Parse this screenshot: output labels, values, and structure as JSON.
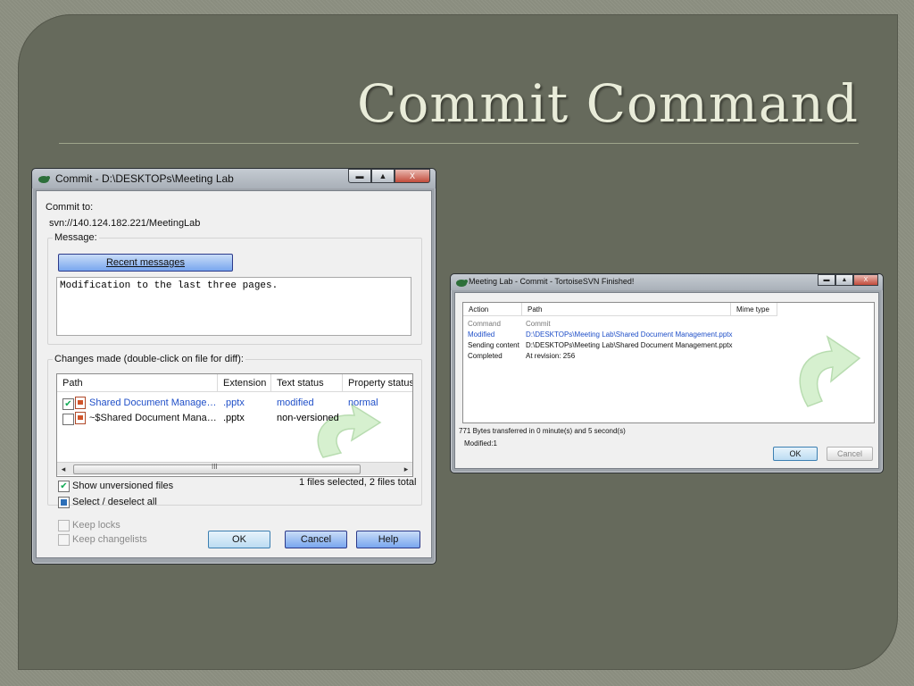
{
  "slide": {
    "title": "Commit Command"
  },
  "commit_dialog": {
    "title": "Commit - D:\\DESKTOPs\\Meeting Lab",
    "commit_to_label": "Commit to:",
    "repo_url": "svn://140.124.182.221/MeetingLab",
    "message_label": "Message:",
    "recent_messages_button": "Recent messages",
    "message_text": "Modification to the last three pages.",
    "changes_label": "Changes made (double-click on file for diff):",
    "columns": [
      "Path",
      "Extension",
      "Text status",
      "Property status"
    ],
    "rows": [
      {
        "checked": true,
        "path": "Shared Document Manage…",
        "extension": ".pptx",
        "text_status": "modified",
        "property_status": "normal"
      },
      {
        "checked": false,
        "path": "~$Shared Document Mana…",
        "extension": ".pptx",
        "text_status": "non-versioned",
        "property_status": ""
      }
    ],
    "scroll_grip": "III",
    "show_unversioned_label": "Show unversioned files",
    "selection_summary": "1 files selected, 2 files total",
    "select_all_label": "Select / deselect all",
    "keep_locks_label": "Keep locks",
    "keep_changelists_label": "Keep changelists",
    "ok_button": "OK",
    "cancel_button": "Cancel",
    "help_button": "Help"
  },
  "finished_dialog": {
    "title": "Meeting Lab - Commit - TortoiseSVN Finished!",
    "columns": [
      "Action",
      "Path",
      "Mime type"
    ],
    "rows": [
      {
        "action": "Command",
        "path": "Commit",
        "kind": "muted"
      },
      {
        "action": "Modified",
        "path": "D:\\DESKTOPs\\Meeting Lab\\Shared Document Management.pptx",
        "kind": "blue"
      },
      {
        "action": "Sending content",
        "path": "D:\\DESKTOPs\\Meeting Lab\\Shared Document Management.pptx",
        "kind": "normal"
      },
      {
        "action": "Completed",
        "path": "At revision: 256",
        "kind": "normal"
      }
    ],
    "transfer_text": "771 Bytes transferred in 0 minute(s) and 5 second(s)",
    "modified_count_text": "Modified:1",
    "ok_button": "OK",
    "cancel_button": "Cancel"
  },
  "window_controls": {
    "minimize": "▬",
    "maximize": "▲",
    "close": "X"
  },
  "colors": {
    "accent_blue": "#1f4fc8",
    "slide_bg": "#666a5c",
    "title_text": "#e9ecd9"
  }
}
